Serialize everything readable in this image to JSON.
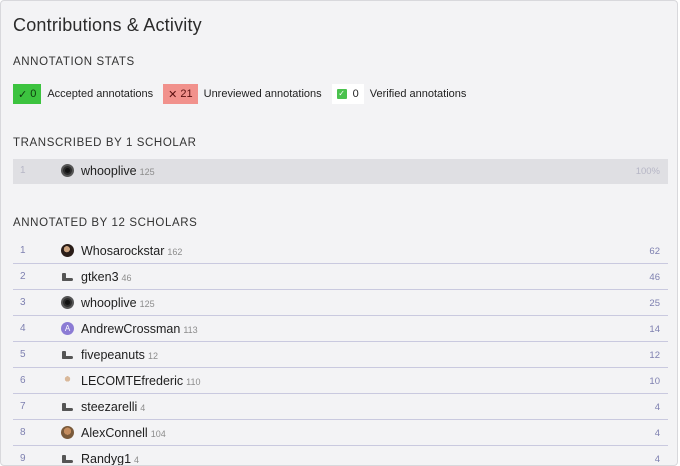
{
  "title": "Contributions & Activity",
  "annotation_stats": {
    "heading": "ANNOTATION STATS",
    "accepted": {
      "count": "0",
      "label": "Accepted annotations",
      "color": "#3cc33f"
    },
    "unreviewed": {
      "count": "21",
      "label": "Unreviewed annotations",
      "color": "#f1918c"
    },
    "verified": {
      "count": "0",
      "label": "Verified annotations"
    }
  },
  "transcribed": {
    "heading": "TRANSCRIBED BY 1 SCHOLAR",
    "rows": [
      {
        "rank": "1",
        "name": "whooplive",
        "score": "125",
        "count": "100%",
        "avatar": "dark-avatar-icon"
      }
    ]
  },
  "annotated": {
    "heading": "ANNOTATED BY 12 SCHOLARS",
    "rows": [
      {
        "rank": "1",
        "name": "Whosarockstar",
        "score": "162",
        "count": "62",
        "avatar": "photo-avatar-icon"
      },
      {
        "rank": "2",
        "name": "gtken3",
        "score": "46",
        "count": "46",
        "avatar": "shoe-avatar-icon"
      },
      {
        "rank": "3",
        "name": "whooplive",
        "score": "125",
        "count": "25",
        "avatar": "dark-avatar-icon"
      },
      {
        "rank": "4",
        "name": "AndrewCrossman",
        "score": "113",
        "count": "14",
        "avatar": "letter-avatar-icon",
        "initial": "A"
      },
      {
        "rank": "5",
        "name": "fivepeanuts",
        "score": "12",
        "count": "12",
        "avatar": "shoe-avatar-icon"
      },
      {
        "rank": "6",
        "name": "LECOMTEfrederic",
        "score": "110",
        "count": "10",
        "avatar": "person-avatar-icon"
      },
      {
        "rank": "7",
        "name": "steezarelli",
        "score": "4",
        "count": "4",
        "avatar": "shoe-avatar-icon"
      },
      {
        "rank": "8",
        "name": "AlexConnell",
        "score": "104",
        "count": "4",
        "avatar": "photo-avatar-icon"
      },
      {
        "rank": "9",
        "name": "Randyg1",
        "score": "4",
        "count": "4",
        "avatar": "shoe-avatar-icon"
      }
    ]
  }
}
